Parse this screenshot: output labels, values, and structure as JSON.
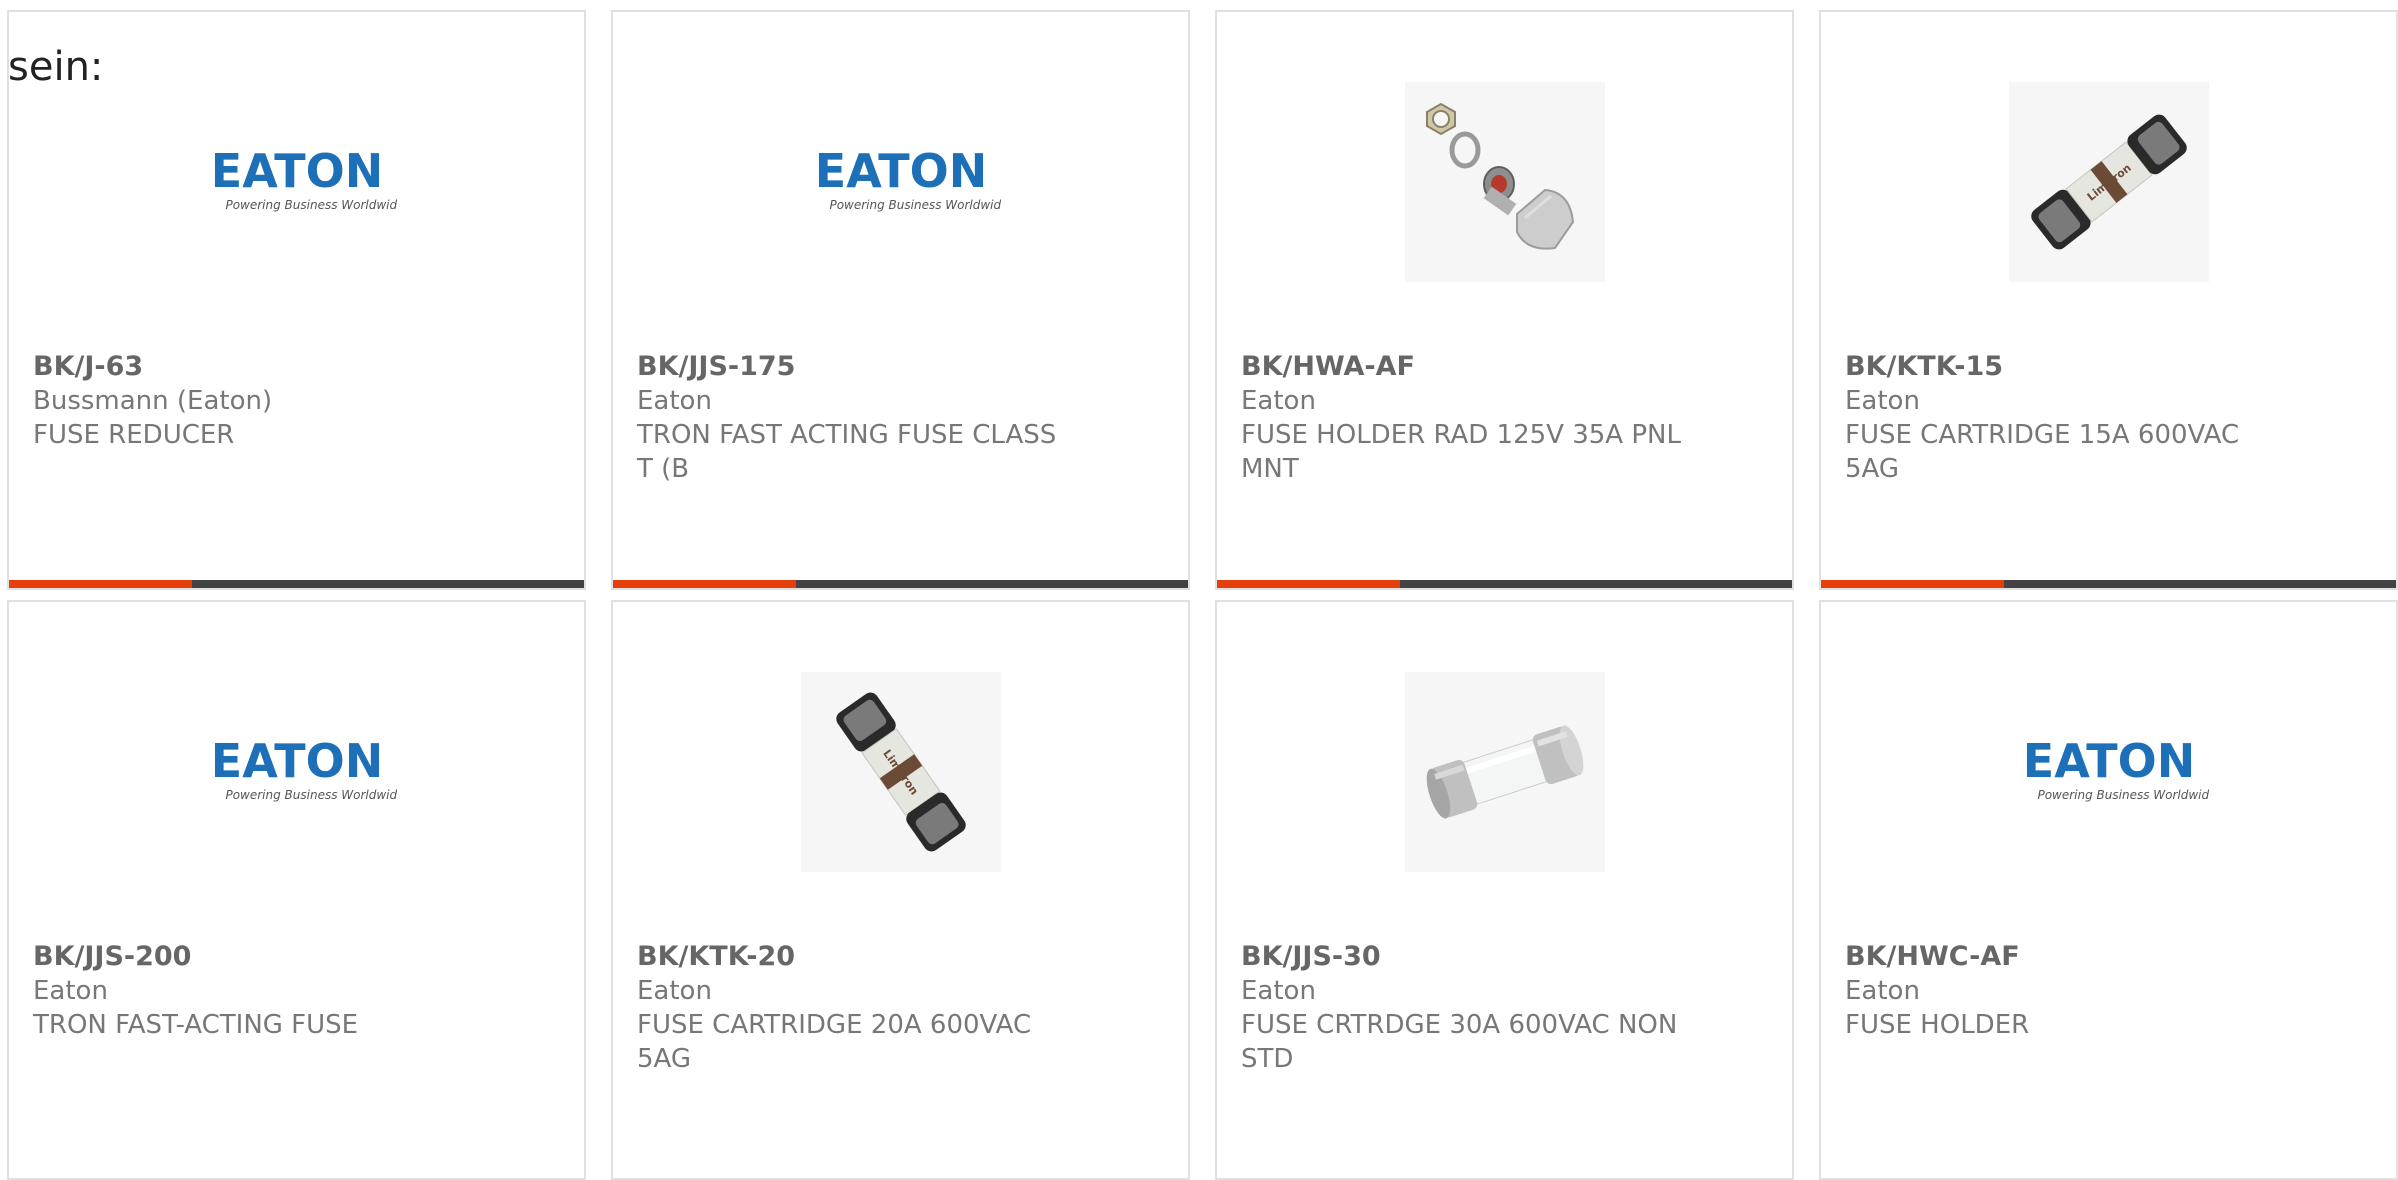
{
  "page": {
    "lead_text": "sein:"
  },
  "logo": {
    "brand": "EATON",
    "tagline": "Powering Business Worldwide",
    "color": "#1d6fb8"
  },
  "colors": {
    "accent": "#e5400c",
    "bar": "#424242"
  },
  "products": [
    {
      "part": "BK/J-63",
      "maker": "Bussmann (Eaton)",
      "desc": "FUSE REDUCER",
      "image": "eaton-logo"
    },
    {
      "part": "BK/JJS-175",
      "maker": "Eaton",
      "desc": "TRON FAST ACTING FUSE CLASS T (B",
      "image": "eaton-logo"
    },
    {
      "part": "BK/HWA-AF",
      "maker": "Eaton",
      "desc": "FUSE HOLDER RAD 125V 35A PNL MNT",
      "image": "fuse-holder-parts"
    },
    {
      "part": "BK/KTK-15",
      "maker": "Eaton",
      "desc": "FUSE CARTRIDGE 15A 600VAC 5AG",
      "image": "limitron-fuse",
      "fuse_label": "Limitron"
    },
    {
      "part": "BK/JJS-200",
      "maker": "Eaton",
      "desc": "TRON FAST-ACTING FUSE",
      "image": "eaton-logo"
    },
    {
      "part": "BK/KTK-20",
      "maker": "Eaton",
      "desc": "FUSE CARTRIDGE 20A 600VAC 5AG",
      "image": "limitron-fuse",
      "fuse_label": "Limitron"
    },
    {
      "part": "BK/JJS-30",
      "maker": "Eaton",
      "desc": "FUSE CRTRDGE 30A 600VAC NON STD",
      "image": "glass-cartridge-fuse"
    },
    {
      "part": "BK/HWC-AF",
      "maker": "Eaton",
      "desc": "FUSE HOLDER",
      "image": "eaton-logo"
    }
  ]
}
